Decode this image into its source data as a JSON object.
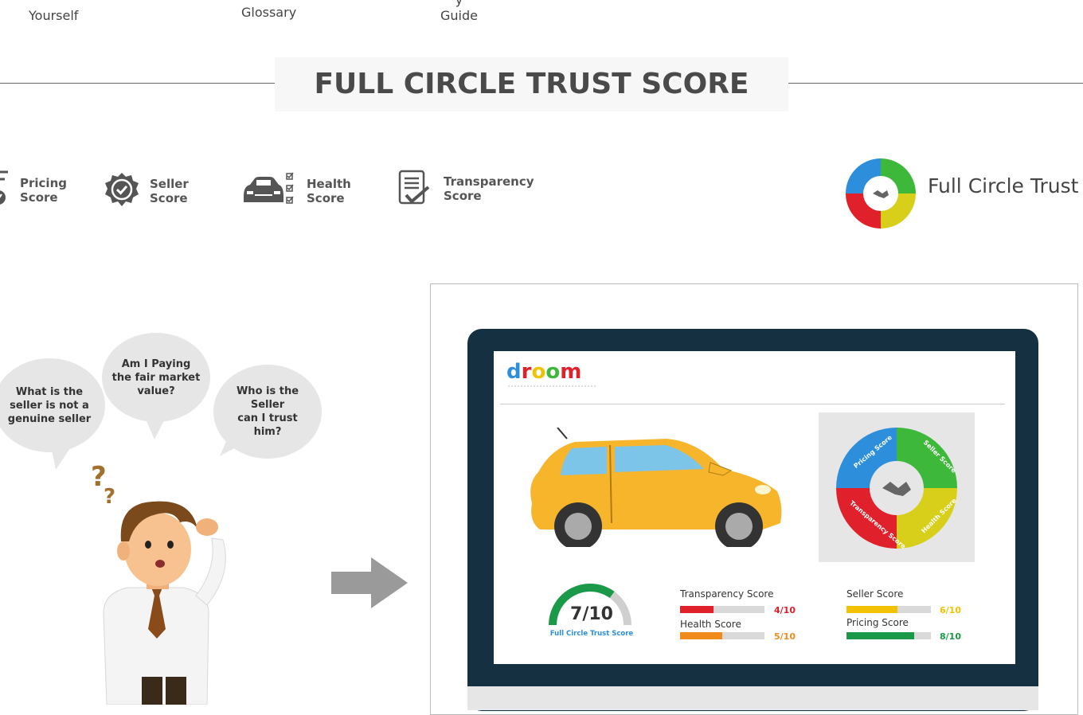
{
  "nav": {
    "item1": "Yourself",
    "item2": "Glossary",
    "item3_line1": "y",
    "item3_line2": "Guide"
  },
  "section": {
    "title": "FULL CIRCLE TRUST SCORE"
  },
  "scores": [
    {
      "line1": "Pricing",
      "line2": "Score",
      "icon": "pricing-icon"
    },
    {
      "line1": "Seller",
      "line2": "Score",
      "icon": "seller-badge-icon"
    },
    {
      "line1": "Health",
      "line2": "Score",
      "icon": "car-health-icon"
    },
    {
      "line1": "Transparency",
      "line2": "Score",
      "icon": "document-check-icon"
    }
  ],
  "full_circle": {
    "label": "Full Circle Trust"
  },
  "bubbles": {
    "b1": [
      "What is the",
      "seller is not a",
      "genuine seller"
    ],
    "b2": [
      "Am I Paying",
      "the fair market",
      "value?"
    ],
    "b3": [
      "Who is the",
      "Seller",
      "can I trust",
      "him?"
    ]
  },
  "laptop": {
    "brand": "droom",
    "wheel_labels": {
      "pricing": "Pricing Score",
      "seller": "Seller Score",
      "health": "Health Score",
      "transparency": "Transparency Score"
    },
    "gauge": {
      "value": "7/10",
      "label": "Full Circle Trust Score",
      "fraction": 0.7
    },
    "bars": [
      {
        "label": "Transparency Score",
        "value": "4/10",
        "fraction": 0.4,
        "color": "#e0202a"
      },
      {
        "label": "Health Score",
        "value": "5/10",
        "fraction": 0.5,
        "color": "#f08a1c"
      },
      {
        "label": "Seller Score",
        "value": "6/10",
        "fraction": 0.6,
        "color": "#f2c200"
      },
      {
        "label": "Pricing Score",
        "value": "8/10",
        "fraction": 0.8,
        "color": "#1a9a48"
      }
    ]
  },
  "colors": {
    "pricing": "#2d8fdc",
    "seller": "#3db83a",
    "health": "#d8cf1a",
    "transparency": "#e0202a",
    "laptop_frame": "#143041",
    "gauge_green": "#1a9a48"
  }
}
